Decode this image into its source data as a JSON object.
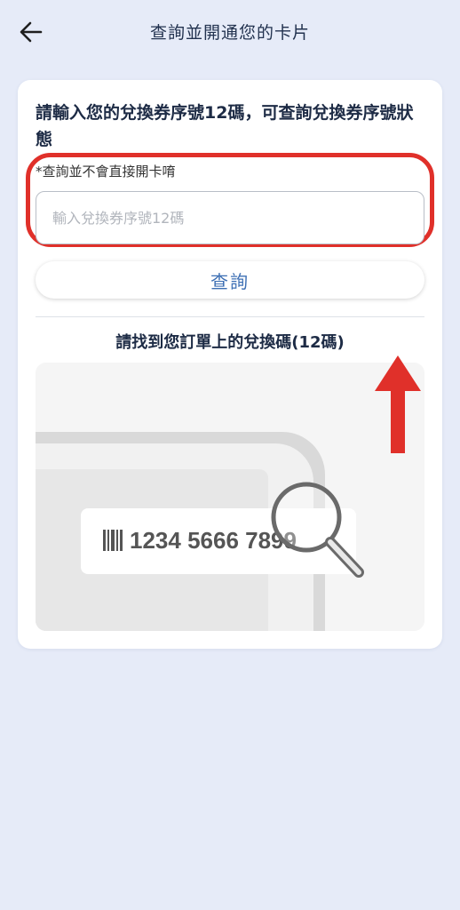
{
  "header": {
    "title": "查詢並開通您的卡片",
    "back_icon": "arrow-left-icon"
  },
  "card": {
    "prompt": "請輸入您的兌換券序號12碼，可查詢兌換券序號狀態",
    "note": "*查詢並不會直接開卡唷",
    "input": {
      "placeholder": "輸入兌換券序號12碼",
      "value": ""
    },
    "query_button_label": "查詢",
    "hint_title": "請找到您訂單上的兌換碼(12碼)",
    "illustration": {
      "example_code": "1234 5666 7899",
      "barcode_icon": "barcode-icon",
      "magnifier_icon": "magnifying-glass-icon"
    }
  },
  "annotation": {
    "arrow_icon": "arrow-up-icon",
    "highlight_color": "#e0302a"
  },
  "colors": {
    "background": "#e6ebf8",
    "accent": "#3d6fb4",
    "title_text": "#22324f"
  }
}
